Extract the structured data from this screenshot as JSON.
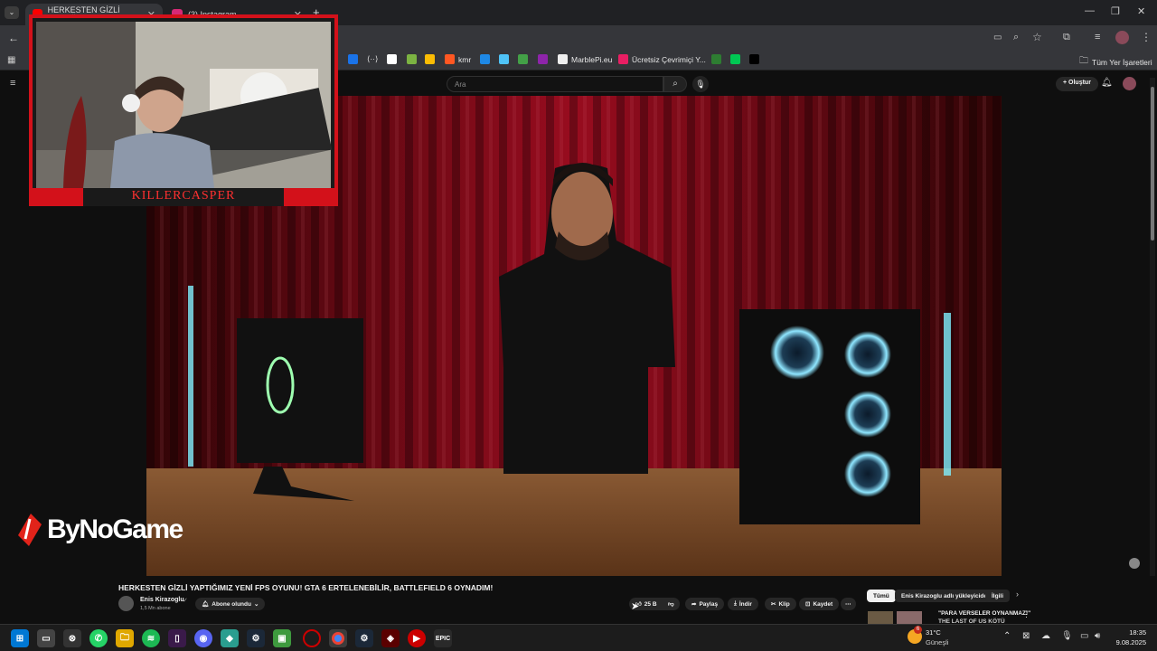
{
  "browser": {
    "tabs": [
      {
        "title": "HERKESTEN GİZLİ YAPTIĞI"
      },
      {
        "title": "(3) Instagram"
      }
    ],
    "new_tab": "+",
    "bookmarks": [
      {
        "label": "",
        "color": "#1a73e8"
      },
      {
        "label": "",
        "color": "#ffffff"
      },
      {
        "label": "⟨··⟩",
        "color": ""
      },
      {
        "label": "",
        "color": "#7cb342"
      },
      {
        "label": "",
        "color": "#fbbc04"
      },
      {
        "label": "kmr",
        "color": "#ff5722"
      },
      {
        "label": "",
        "color": "#1e88e5"
      },
      {
        "label": "",
        "color": "#4fc3f7"
      },
      {
        "label": "",
        "color": "#43a047"
      },
      {
        "label": "",
        "color": "#8e24aa"
      },
      {
        "label": "MarblePi.eu",
        "color": "#eeeeee"
      },
      {
        "label": "Ücretsiz Çevrimiçi Y...",
        "color": "#e91e63"
      },
      {
        "label": "",
        "color": "#2e7d32"
      },
      {
        "label": "",
        "color": "#00c853"
      },
      {
        "label": "",
        "color": "#000000"
      }
    ],
    "all_bookmarks": "Tüm Yer İşaretleri"
  },
  "youtube": {
    "search_placeholder": "Ara",
    "create_label": "Oluştur",
    "video_title": "HERKESTEN GİZLİ YAPTIĞIMIZ YENİ FPS OYUNU! GTA 6 ERTELENEBİLİR, BATTLEFIELD 6 OYNADIM!",
    "channel_name": "Enis Kirazoglu",
    "subscribers": "1,5 Mn abone",
    "subscribed_label": "Abone olundu",
    "likes": "25 B",
    "share_label": "Paylaş",
    "download_label": "İndir",
    "clip_label": "Klip",
    "save_label": "Kaydet",
    "chips": [
      "Tümü",
      "Enis Kirazoglu adlı yükleyiciden",
      "İlgili"
    ],
    "rec_title_1": "\"PARA VERSELER OYNANMAZ!\"",
    "rec_title_2": "THE LAST OF US KÖTÜ"
  },
  "overlay": {
    "streamer_name": "KILLERCASPER",
    "watermark": "ByNoGame"
  },
  "taskbar": {
    "weather_temp": "31°C",
    "weather_desc": "Güneşli",
    "weather_badge": "6",
    "time": "18:35",
    "date": "9.08.2025"
  }
}
